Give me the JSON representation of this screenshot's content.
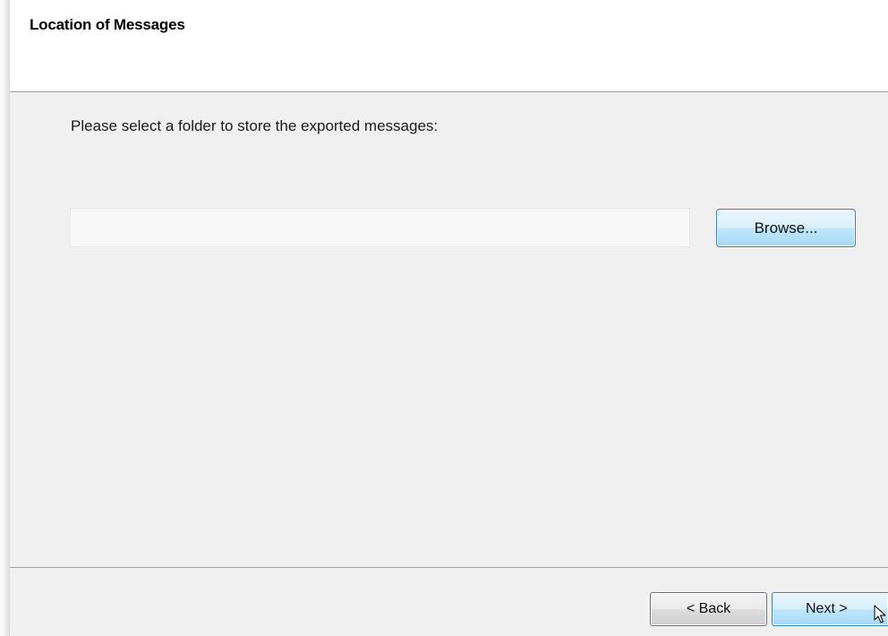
{
  "header": {
    "title": "Location of Messages"
  },
  "main": {
    "instruction": "Please select a folder to store the exported messages:",
    "folder_path": {
      "value": "",
      "placeholder": ""
    },
    "browse_label": "Browse..."
  },
  "footer": {
    "back_label": "< Back",
    "next_label": "Next >"
  },
  "colors": {
    "content_bg": "#f0f0f0",
    "header_bg": "#ffffff",
    "focus_border": "#3c7fb1"
  },
  "icons": {
    "cursor": "mouse-pointer-icon"
  }
}
